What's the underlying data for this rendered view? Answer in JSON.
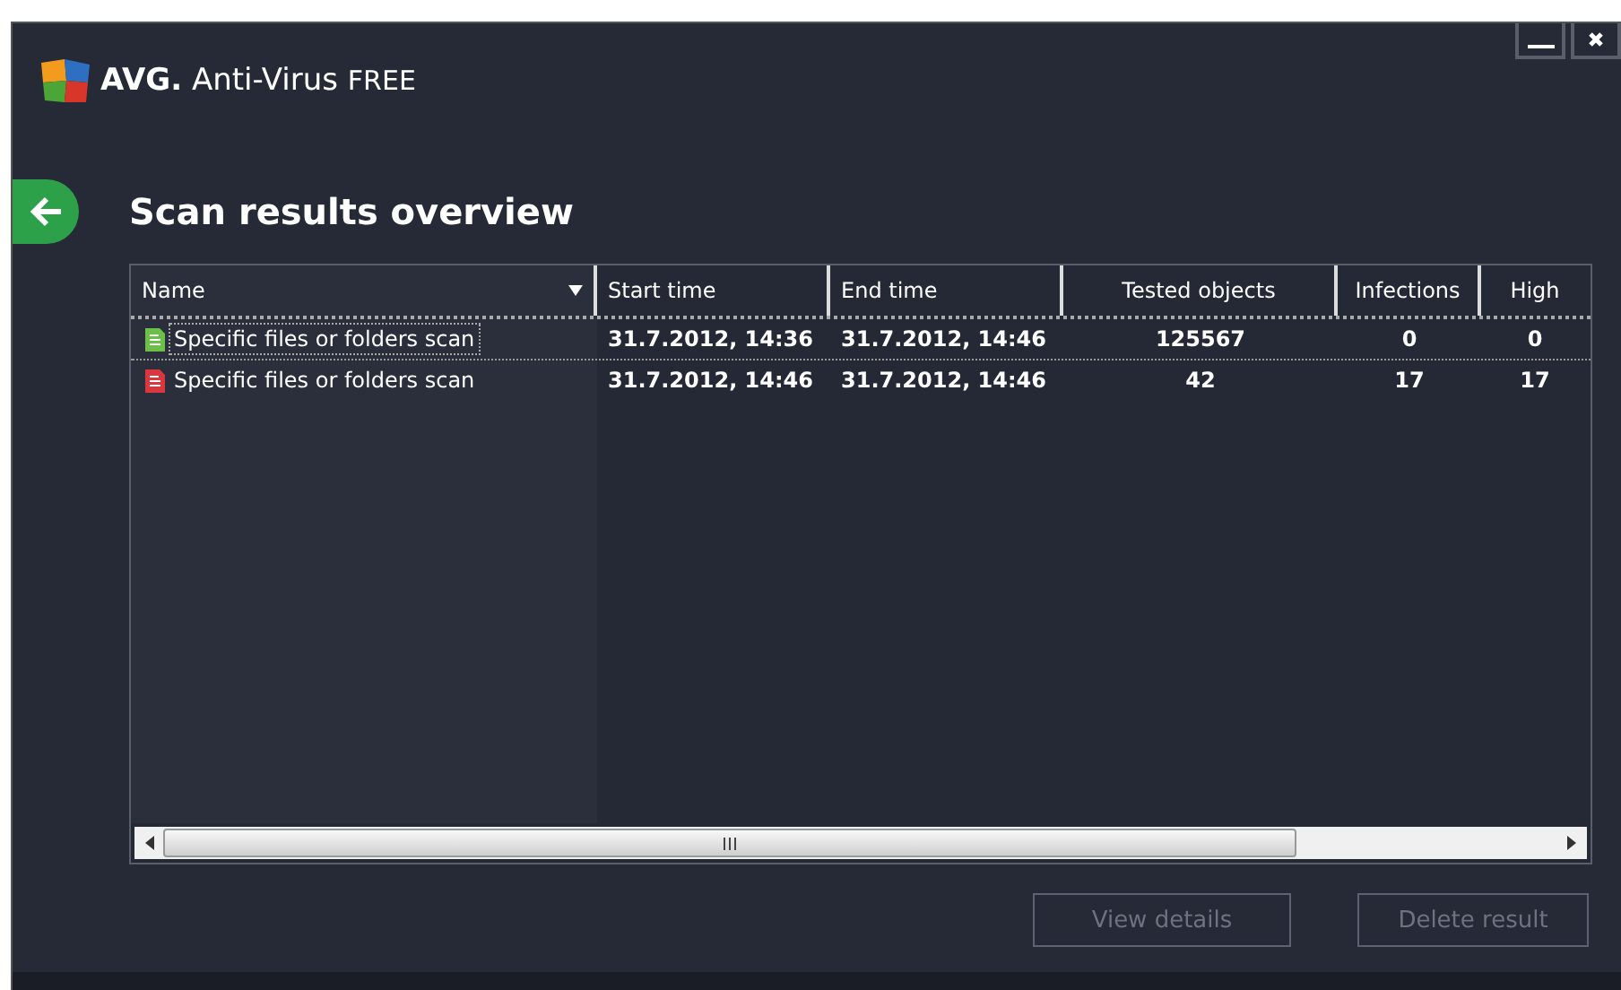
{
  "window": {
    "brand": "AVG.",
    "product": "Anti-Virus",
    "edition": "FREE"
  },
  "page": {
    "title": "Scan results overview"
  },
  "table": {
    "columns": [
      {
        "label": "Name",
        "sorted": true
      },
      {
        "label": "Start time",
        "sorted": false
      },
      {
        "label": "End time",
        "sorted": false
      },
      {
        "label": "Tested objects",
        "sorted": false
      },
      {
        "label": "Infections",
        "sorted": false
      },
      {
        "label": "High",
        "sorted": false
      }
    ],
    "rows": [
      {
        "color": "#6cc04a",
        "selected": true,
        "cells": [
          "Specific files or folders scan",
          "31.7.2012, 14:36",
          "31.7.2012, 14:46",
          "125567",
          "0",
          "0"
        ]
      },
      {
        "color": "#d9363e",
        "selected": false,
        "cells": [
          "Specific files or folders scan",
          "31.7.2012, 14:46",
          "31.7.2012, 14:46",
          "42",
          "17",
          "17"
        ]
      }
    ]
  },
  "buttons": [
    {
      "label": "View details",
      "disabled": true
    },
    {
      "label": "Delete result",
      "disabled": true
    }
  ]
}
